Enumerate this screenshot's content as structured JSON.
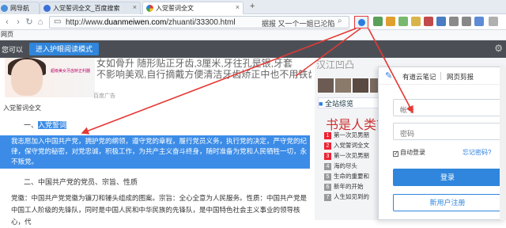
{
  "tabs": [
    {
      "label": "网导航",
      "active": false
    },
    {
      "label": "入党誓词全文_百度搜索",
      "active": false
    },
    {
      "label": "入党誓词全文",
      "active": true
    }
  ],
  "new_tab": "+",
  "address": {
    "url_prefix": "http://www.",
    "url_domain": "duanmeiwen.com",
    "url_path": "/zhuanti/33300.html",
    "search_text": "据报 又一个一姐已沦陷"
  },
  "bookmark_label": "网页",
  "prompt_bar": {
    "label": "您可以",
    "button": "进入护眼阅读模式"
  },
  "content": {
    "ad_line1": "女如骨升 随形贴正牙齿,3厘米,牙往孔是银,牙套",
    "ad_line2": "不影响美观,自行摘戴方便清洁牙齿矫正中也不用铁齿",
    "ad_thumb_text": "超级美女牙齿矫正利器",
    "ad_label": "百度广告",
    "breadcrumb": "入党誓词全文",
    "heading1_prefix": "一、",
    "heading1_selected": "入党誓词",
    "paragraph1": "我志愿加入中国共产党，拥护党的纲领，遵守党的章程，履行党员义务，执行党的决定，严守党的纪律，保守党的秘密，对党忠诚，积极工作，为共产主义奋斗终身，随时准备为党和人民牺牲一切，永不叛党。",
    "heading2": "二、中国共产党的党员、宗旨、性质",
    "paragraph2_line1": "党徽：中国共产党党徽为镰刀和锤头组成的图案。宗旨：全心全意为人民服务。性质：中国共产党是",
    "paragraph2_line2": "中国工人阶级的先锋队，同时是中国人民和中华民族的先锋队，是中国特色社会主义事业的领导核心，代"
  },
  "sidebar": {
    "top_text": "汉江凹凸",
    "section_title": "全站综览",
    "big_title": "书是人类前",
    "items": [
      {
        "num": "1",
        "label": "第一次见男朋"
      },
      {
        "num": "2",
        "label": "入党誓词全文"
      },
      {
        "num": "3",
        "label": "第一次见男朋"
      },
      {
        "num": "4",
        "label": "海的尽头"
      },
      {
        "num": "5",
        "label": "生命的重要和"
      },
      {
        "num": "6",
        "label": "新年的开始"
      },
      {
        "num": "7",
        "label": "人生如见到的"
      }
    ]
  },
  "popup": {
    "tab_note": "有道云笔记",
    "tab_clip": "网页剪报",
    "account_placeholder": "帐号",
    "password_placeholder": "密码",
    "remember": "自动登录",
    "forgot": "忘记密码?",
    "login": "登录",
    "register": "新用户注册"
  },
  "colors": {
    "accent": "#2f86dc",
    "selection": "#3c8ce7",
    "annotation": "#e53935"
  }
}
